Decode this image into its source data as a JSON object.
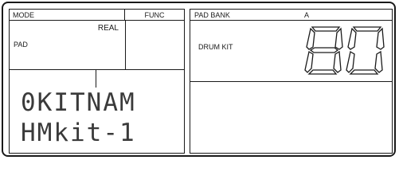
{
  "mode": {
    "label": "MODE",
    "sub": "REAL",
    "value": "PAD"
  },
  "func": {
    "label": "FUNC"
  },
  "pad_bank": {
    "label": "PAD BANK",
    "value": "A"
  },
  "drum_kit": {
    "label": "DRUM KIT",
    "number": "80"
  },
  "lcd": {
    "line1": "0KITNAM",
    "line2": "HMkit-1"
  }
}
